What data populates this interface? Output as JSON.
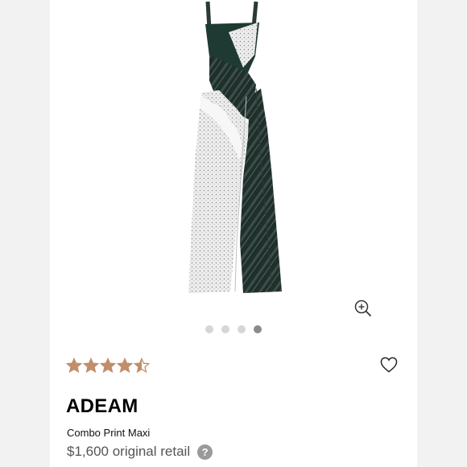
{
  "product": {
    "brand": "ADEAM",
    "name": "Combo Print Maxi",
    "price": "$1,600 original retail",
    "rating": 4.5,
    "rating_max": 5
  },
  "gallery": {
    "image_count": 4,
    "active_index": 3
  },
  "icons": {
    "zoom": "zoom-in-icon",
    "favorite": "heart-outline-icon",
    "help": "question-icon",
    "help_glyph": "?"
  },
  "colors": {
    "star": "#c08e6a",
    "dot_active": "#8a8a8a",
    "dot_inactive": "#d6d6d6",
    "help_bg": "#9a9a9a"
  }
}
